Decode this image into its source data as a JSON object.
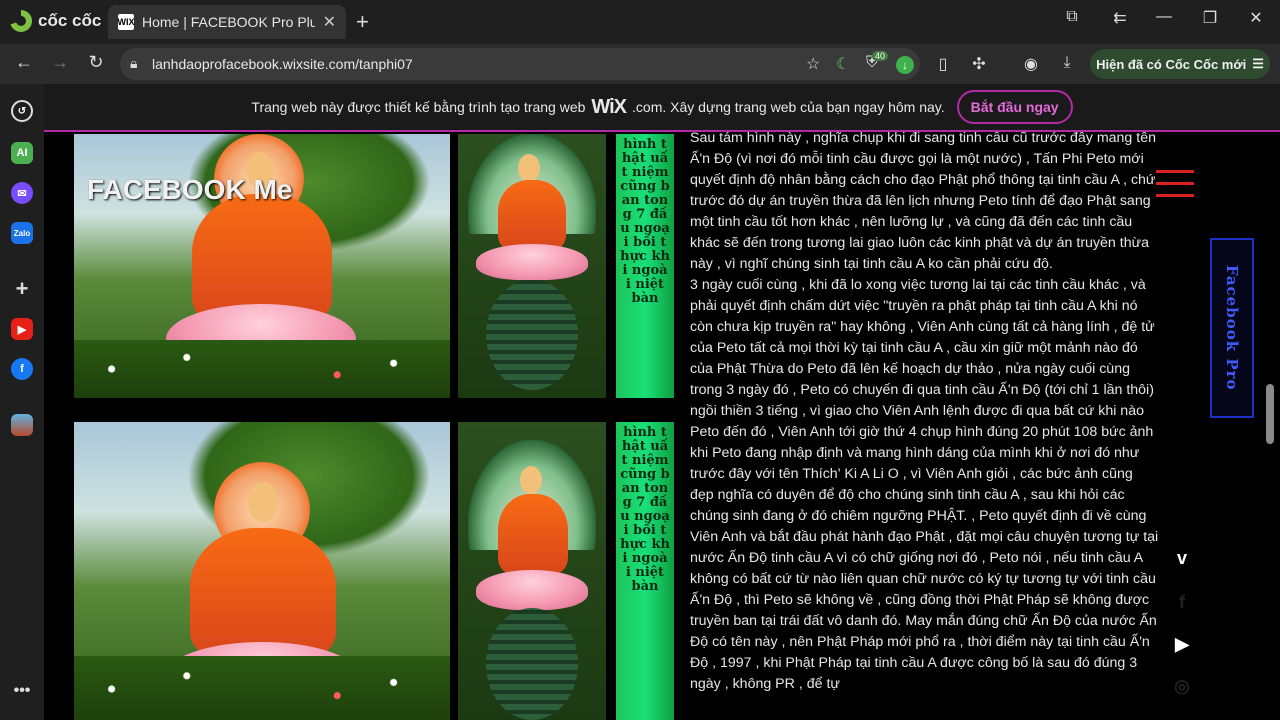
{
  "browser": {
    "brand": "cốc cốc",
    "tab_title": "Home | FACEBOOK Pro Plus",
    "tab_favicon": "WIX",
    "url": "lanhdaoprofacebook.wixsite.com/tanphi07",
    "extension_badge": "40",
    "update_button": "Hiện đã có Cốc Cốc mới"
  },
  "wix_banner": {
    "text_before": "Trang web này được thiết kế bằng trình tạo trang web",
    "wix_logo": "WiX",
    "text_after": ".com. Xây dựng trang web của bạn ngay hôm nay.",
    "cta": "Bắt đầu ngay"
  },
  "site": {
    "logo_text": "FACEBOOK Me",
    "side_button": "Facebook Pro",
    "strip_text": "hình thật uất niệm cũng ban tong 7 đầu ngoại bồi thực khi ngoài niệt bàn"
  },
  "article": {
    "paragraphs": [
      "Sau tám hình này , nghĩa chụp khi đi sang tinh cầu cũ trước đây mang tên Ấ'n Độ (vì nơi đó mỗi tinh cầu được gọi là một nước) , Tấn Phi Peto mới quyết định độ nhân bằng cách cho đạo Phật phổ thông tại tinh cầu A , chứ trước đó dự án truyền thừa đã lên lịch nhưng Peto tính để đạo Phật sang một tinh cầu tốt hơn khác , nên lưỡng lự , và cũng đã đến các tinh cầu khác sẽ đến trong tương lai giao luôn các kinh phật và dự án truyền thừa này , vì nghĩ chúng sinh tại tinh cầu A ko cần phải cứu độ.",
      "3 ngày cuối cùng , khi đã lo xong việc tương lai tại các tinh cầu khác , và phải quyết định chấm dứt việc \"truyền ra phật pháp tại tinh cầu A khi nó còn chưa kịp truyền ra\" hay không , Viên Anh cùng tất cả hàng lính , đệ tử của Peto tất cả mọi thời kỳ tại tinh cầu A , cầu xin giữ một mảnh nào đó của Phật Thừa do Peto đã lên kế hoạch dự thảo , nửa ngày cuối cùng trong 3 ngày đó , Peto có chuyến đi qua tinh cầu Ấ'n Độ (tới chỉ 1 lần thôi) ngồi thiền 3 tiếng , vì giao cho Viên Anh lệnh được đi qua bất cứ khi nào Peto đến đó , Viên Anh tới giờ thứ 4 chụp hình đúng 20 phút 108 bức ảnh khi Peto đang nhập định và mang hình dáng của mình khi ở nơi đó như trước đây với tên Thích' Ki A Li O , vì Viên Anh giỏi , các bức ảnh cũng đẹp nghĩa có duyên để độ cho chúng sinh tinh cầu A , sau khi hỏi các chúng sinh đang ở đó chiêm ngưỡng PHẬT. , Peto quyết định đi về cùng Viên Anh và bắt đầu phát hành đạo Phật , đặt mọi câu chuyện tương tự tại nước Ấn Độ tinh cầu A vì có chữ giống nơi đó , Peto nói , nếu tinh cầu A không có bất cứ từ nào liên quan chữ nước có ký tự tương tự với tinh cầu Ấ'n Độ , thì Peto sẽ không về , cũng đồng thời Phật Pháp sẽ không được truyền ban tại trái đất vô danh đó. May mắn đúng chữ Ấn Độ của nước Ấn Độ có tên này , nên Phật Pháp mới phổ ra , thời điểm này tại tinh cầu Ấ'n Độ , 1997 , khi Phật Pháp tại tinh cầu A được công bố là sau đó đúng 3 ngày , không PR , để tự"
    ]
  },
  "colors": {
    "wix_accent": "#b22aa6",
    "menu_red": "#d9221f",
    "side_button_blue": "#3f5bff"
  },
  "icons": [
    "history-icon",
    "ai-icon",
    "messenger-icon",
    "zalo-icon",
    "plus-icon",
    "youtube-icon",
    "facebook-icon",
    "game-icon",
    "more-icon",
    "vimeo-icon",
    "facebook-icon",
    "youtube-icon",
    "instagram-icon"
  ]
}
